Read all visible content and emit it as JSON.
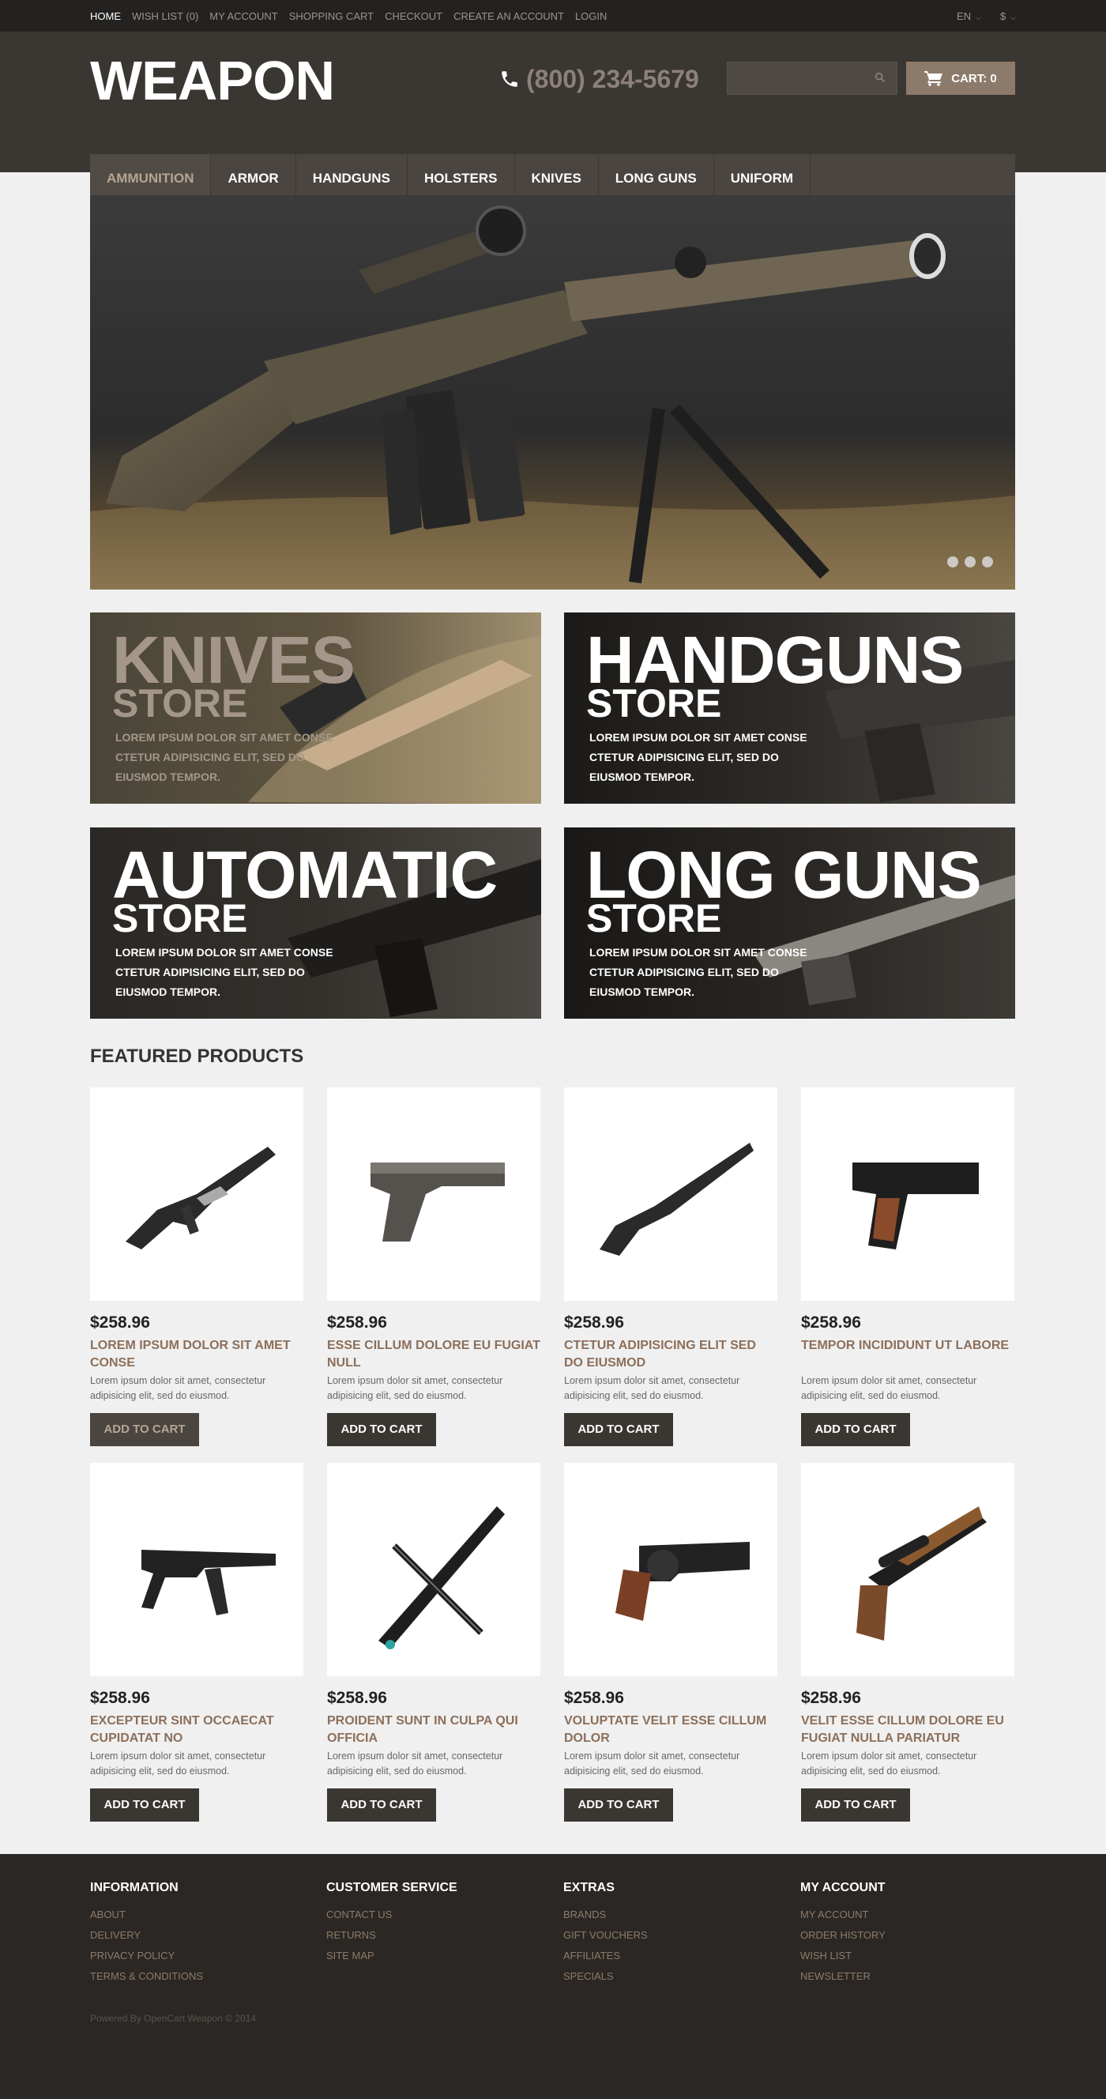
{
  "topbar": {
    "links": [
      "HOME",
      "WISH LIST (0)",
      "MY ACCOUNT",
      "SHOPPING CART",
      "CHECKOUT",
      "CREATE AN ACCOUNT",
      "LOGIN"
    ],
    "language": "EN",
    "currency": "$"
  },
  "header": {
    "logo": "WEAPON",
    "phone": "(800) 234-5679",
    "search_placeholder": "",
    "cart_label": "CART: 0"
  },
  "nav": {
    "items": [
      "AMMUNITION",
      "ARMOR",
      "HANDGUNS",
      "HOLSTERS",
      "KNIVES",
      "LONG GUNS",
      "UNIFORM"
    ],
    "active_index": 0
  },
  "hero": {
    "slide_count": 3,
    "active_slide": 0
  },
  "banners": [
    {
      "title": "KNIVES",
      "subtitle": "STORE",
      "text": "LOREM IPSUM DOLOR SIT AMET CONSE CTETUR ADIPISICING ELIT, SED DO EIUSMOD TEMPOR."
    },
    {
      "title": "HANDGUNS",
      "subtitle": "STORE",
      "text": "LOREM IPSUM DOLOR SIT AMET CONSE CTETUR ADIPISICING ELIT, SED DO EIUSMOD TEMPOR."
    },
    {
      "title": "AUTOMATIC",
      "subtitle": "STORE",
      "text": "LOREM IPSUM DOLOR SIT AMET CONSE CTETUR ADIPISICING ELIT, SED DO EIUSMOD TEMPOR."
    },
    {
      "title": "LONG GUNS",
      "subtitle": "STORE",
      "text": "LOREM IPSUM DOLOR SIT AMET CONSE CTETUR ADIPISICING ELIT, SED DO EIUSMOD TEMPOR."
    }
  ],
  "featured": {
    "title": "FEATURED PRODUCTS",
    "products": [
      {
        "price": "$258.96",
        "name": "LOREM IPSUM DOLOR SIT AMET CONSE",
        "desc": "Lorem ipsum dolor sit amet, consectetur adipisicing elit, sed do eiusmod.",
        "button": "ADD TO CART",
        "icon": "submachine-gun-icon"
      },
      {
        "price": "$258.96",
        "name": "ESSE CILLUM DOLORE EU FUGIAT NULL",
        "desc": "Lorem ipsum dolor sit amet, consectetur adipisicing elit, sed do eiusmod.",
        "button": "ADD TO CART",
        "icon": "pistol-icon"
      },
      {
        "price": "$258.96",
        "name": "CTETUR ADIPISICING ELIT SED DO EIUSMOD",
        "desc": "Lorem ipsum dolor sit amet, consectetur adipisicing elit, sed do eiusmod.",
        "button": "ADD TO CART",
        "icon": "shotgun-icon"
      },
      {
        "price": "$258.96",
        "name": "TEMPOR INCIDIDUNT UT LABORE",
        "desc": "Lorem ipsum dolor sit amet, consectetur adipisicing elit, sed do eiusmod.",
        "button": "ADD TO CART",
        "icon": "pistol-icon"
      },
      {
        "price": "$258.96",
        "name": "EXCEPTEUR SINT OCCAECAT CUPIDATAT NO",
        "desc": "Lorem ipsum dolor sit amet, consectetur adipisicing elit, sed do eiusmod.",
        "button": "ADD TO CART",
        "icon": "submachine-gun-icon"
      },
      {
        "price": "$258.96",
        "name": "PROIDENT SUNT IN CULPA QUI OFFICIA",
        "desc": "Lorem ipsum dolor sit amet, consectetur adipisicing elit, sed do eiusmod.",
        "button": "ADD TO CART",
        "icon": "crossbow-icon"
      },
      {
        "price": "$258.96",
        "name": "VOLUPTATE VELIT ESSE CILLUM DOLOR",
        "desc": "Lorem ipsum dolor sit amet, consectetur adipisicing elit, sed do eiusmod.",
        "button": "ADD TO CART",
        "icon": "revolver-icon"
      },
      {
        "price": "$258.96",
        "name": "VELIT ESSE CILLUM DOLORE EU FUGIAT NULLA PARIATUR",
        "desc": "Lorem ipsum dolor sit amet, consectetur adipisicing elit, sed do eiusmod.",
        "button": "ADD TO CART",
        "icon": "scoped-rifle-icon"
      }
    ]
  },
  "footer": {
    "columns": [
      {
        "title": "INFORMATION",
        "links": [
          "ABOUT",
          "DELIVERY",
          "PRIVACY POLICY",
          "TERMS & CONDITIONS"
        ]
      },
      {
        "title": "CUSTOMER SERVICE",
        "links": [
          "CONTACT US",
          "RETURNS",
          "SITE MAP"
        ]
      },
      {
        "title": "EXTRAS",
        "links": [
          "BRANDS",
          "GIFT VOUCHERS",
          "AFFILIATES",
          "SPECIALS"
        ]
      },
      {
        "title": "MY ACCOUNT",
        "links": [
          "MY ACCOUNT",
          "ORDER HISTORY",
          "WISH LIST",
          "NEWSLETTER"
        ]
      }
    ],
    "powered": "Powered By OpenCart Weapon © 2014"
  },
  "colors": {
    "accent": "#8c7b6b",
    "dark": "#3a3632",
    "product_name": "#8c6f5a"
  }
}
